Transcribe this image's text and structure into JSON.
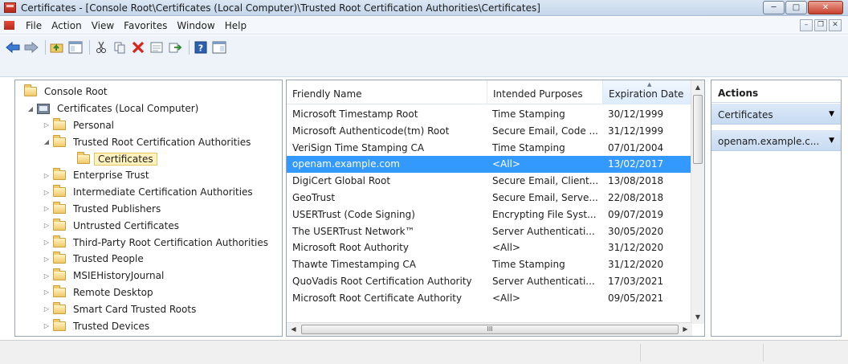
{
  "window": {
    "title": "Certificates - [Console Root\\Certificates (Local Computer)\\Trusted Root Certification Authorities\\Certificates]",
    "controls": {
      "minimize": "─",
      "maximize": "□",
      "close": "✕"
    }
  },
  "menu": {
    "items": [
      "File",
      "Action",
      "View",
      "Favorites",
      "Window",
      "Help"
    ],
    "mdi": {
      "minimize": "–",
      "restore": "❐",
      "close": "✕"
    }
  },
  "toolbar": {
    "icons": [
      "back-arrow-icon",
      "forward-arrow-icon",
      "up-folder-icon",
      "show-tree-icon",
      "cut-icon",
      "copy-icon",
      "delete-icon",
      "properties-icon",
      "export-icon",
      "help-icon",
      "action-pane-icon"
    ],
    "colors": {
      "nav": "#3a7bd5",
      "delete": "#d9261c",
      "help": "#2b5fb0"
    }
  },
  "tree": {
    "items": [
      {
        "label": "Console Root",
        "level": 0,
        "expander": "",
        "icon": "folder-icon"
      },
      {
        "label": "Certificates (Local Computer)",
        "level": 1,
        "expander": "◢",
        "icon": "computer-icon"
      },
      {
        "label": "Personal",
        "level": 2,
        "expander": "▷",
        "icon": "folder-icon"
      },
      {
        "label": "Trusted Root Certification Authorities",
        "level": 2,
        "expander": "◢",
        "icon": "folder-icon"
      },
      {
        "label": "Certificates",
        "level": 3,
        "expander": "",
        "icon": "folder-icon",
        "selected": true
      },
      {
        "label": "Enterprise Trust",
        "level": 2,
        "expander": "▷",
        "icon": "folder-icon"
      },
      {
        "label": "Intermediate Certification Authorities",
        "level": 2,
        "expander": "▷",
        "icon": "folder-icon"
      },
      {
        "label": "Trusted Publishers",
        "level": 2,
        "expander": "▷",
        "icon": "folder-icon"
      },
      {
        "label": "Untrusted Certificates",
        "level": 2,
        "expander": "▷",
        "icon": "folder-icon"
      },
      {
        "label": "Third-Party Root Certification Authorities",
        "level": 2,
        "expander": "▷",
        "icon": "folder-icon"
      },
      {
        "label": "Trusted People",
        "level": 2,
        "expander": "▷",
        "icon": "folder-icon"
      },
      {
        "label": "MSIEHistoryJournal",
        "level": 2,
        "expander": "▷",
        "icon": "folder-icon"
      },
      {
        "label": "Remote Desktop",
        "level": 2,
        "expander": "▷",
        "icon": "folder-icon"
      },
      {
        "label": "Smart Card Trusted Roots",
        "level": 2,
        "expander": "▷",
        "icon": "folder-icon"
      },
      {
        "label": "Trusted Devices",
        "level": 2,
        "expander": "▷",
        "icon": "folder-icon"
      }
    ]
  },
  "list": {
    "columns": [
      "Friendly Name",
      "Intended Purposes",
      "Expiration Date"
    ],
    "sorted_column": 2,
    "sort_glyph": "▲",
    "selected_row": 3,
    "rows": [
      [
        "Microsoft Timestamp Root",
        "Time Stamping",
        "30/12/1999"
      ],
      [
        "Microsoft Authenticode(tm) Root",
        "Secure Email, Code ...",
        "31/12/1999"
      ],
      [
        "VeriSign Time Stamping CA",
        "Time Stamping",
        "07/01/2004"
      ],
      [
        "openam.example.com",
        "<All>",
        "13/02/2017"
      ],
      [
        "DigiCert Global Root",
        "Secure Email, Client...",
        "13/08/2018"
      ],
      [
        "GeoTrust",
        "Secure Email, Serve...",
        "22/08/2018"
      ],
      [
        "USERTrust (Code Signing)",
        "Encrypting File Syst...",
        "09/07/2019"
      ],
      [
        "The USERTrust Network™",
        "Server Authenticati...",
        "30/05/2020"
      ],
      [
        "Microsoft Root Authority",
        "<All>",
        "31/12/2020"
      ],
      [
        "Thawte Timestamping CA",
        "Time Stamping",
        "31/12/2020"
      ],
      [
        "QuoVadis Root Certification Authority",
        "Server Authenticati...",
        "17/03/2021"
      ],
      [
        "Microsoft Root Certificate Authority",
        "<All>",
        "09/05/2021"
      ]
    ],
    "scroll": {
      "up": "▲",
      "down": "▼",
      "left": "◀",
      "right": "▶",
      "grip": "III"
    }
  },
  "actions": {
    "title": "Actions",
    "items": [
      "Certificates",
      "openam.example.c..."
    ],
    "arrow": "▼"
  }
}
